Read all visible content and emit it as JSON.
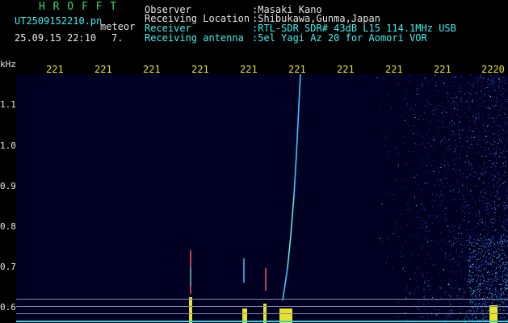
{
  "header": {
    "hrofft_label": "H R O F F T",
    "filename": "UT2509152210.pn",
    "meteor_label": "meteor",
    "datetime": "25.09.15 22:10",
    "count": "7.",
    "observer_label": "Observer",
    "observer_value": ":Masaki Kano",
    "location_label": "Receiving Location",
    "location_value": ":Shibukawa,Gunma,Japan",
    "receiver_label": "Receiver",
    "receiver_value": ":RTL-SDR SDR# 43dB L15 114.1MHz USB",
    "antenna_label": "Receiving antenna",
    "antenna_value": ":5el Yagi Az 20 for Aomori VOR"
  },
  "y_axis": {
    "unit": "kHz",
    "labels": [
      "1.1",
      "1.0",
      "0.9",
      "0.8",
      "0.7",
      "0.6"
    ]
  },
  "time_axis": {
    "labels": [
      "221",
      "221",
      "221",
      "221",
      "221",
      "221",
      "221",
      "221",
      "221",
      "2220"
    ]
  },
  "colors": {
    "background": "#000022",
    "header_cyan": "#3ef0f0",
    "header_white": "#e6e6e6",
    "title_green": "#2fd86a",
    "tick_yellow": "#e8e22a"
  }
}
